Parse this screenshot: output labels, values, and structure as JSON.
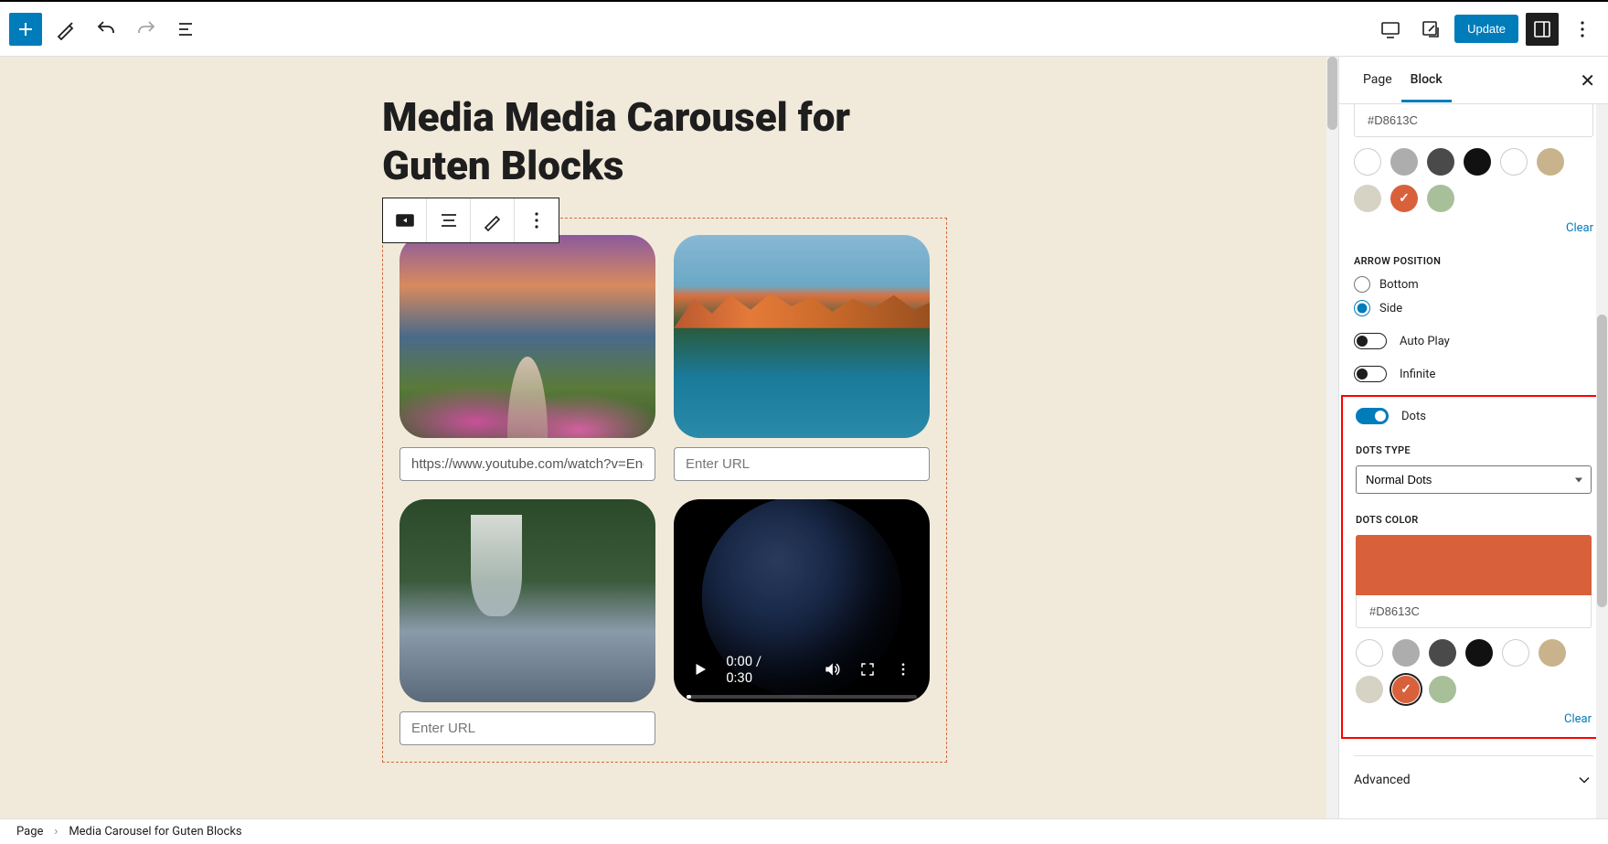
{
  "topbar": {
    "update_label": "Update"
  },
  "canvas": {
    "page_title": "Media Media Carousel for Guten Blocks",
    "url_value_1": "https://www.youtube.com/watch?v=EngV",
    "url_placeholder": "Enter URL",
    "video_time": "0:00 / 0:30"
  },
  "sidebar": {
    "tab_page": "Page",
    "tab_block": "Block",
    "hex1": "#D8613C",
    "arrow_label": "ARROW POSITION",
    "arrow_bottom": "Bottom",
    "arrow_side": "Side",
    "autoplay": "Auto Play",
    "infinite": "Infinite",
    "dots": "Dots",
    "dots_type_label": "DOTS TYPE",
    "dots_type_value": "Normal Dots",
    "dots_color_label": "DOTS COLOR",
    "dots_color_hex": "#D8613C",
    "clear": "Clear",
    "advanced": "Advanced",
    "swatches1": [
      "#ffffff",
      "#adadad",
      "#4a4a4a",
      "#111111",
      "#ffffff",
      "#c9b38c",
      "#d6d2c4",
      "#d8613c",
      "#a8c09a"
    ],
    "swatches2": [
      "#ffffff",
      "#adadad",
      "#4a4a4a",
      "#111111",
      "#ffffff",
      "#c9b38c",
      "#d6d2c4",
      "#d8613c",
      "#a8c09a"
    ]
  },
  "footer": {
    "crumb1": "Page",
    "crumb2": "Media Carousel for Guten Blocks"
  }
}
